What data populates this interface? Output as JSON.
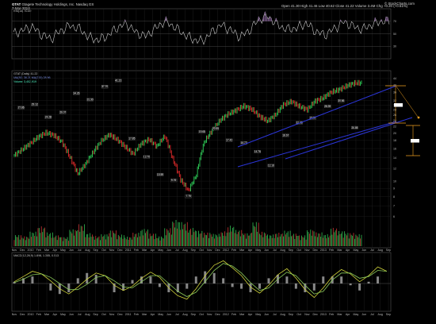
{
  "header": {
    "ticker": "GTAT",
    "company": "Gtagete Technology Holdings, Inc.",
    "exchange": "Nasdaq GS",
    "date": "7-Mar-2013",
    "ohlc": "Open 41.30  High 41.46  Low 40.62  Close 41.22  Volume 3.4M  Chg +0.20 (+0.51%)",
    "brand": "© StockCharts.com"
  },
  "panels": {
    "rsi_label": "RSI(14) 70.69",
    "price_label": "GTAT (Daily) 41.22",
    "ma_label": "MA(50) 38.21  MA(200) 28.96",
    "volume_label": "Volume 3,402,919",
    "macd_label": "MACD(12,26,9) 1.898, 1.385, 0.513"
  },
  "colors": {
    "background": "#000000",
    "grid": "#1d1d1d",
    "up": "#2fd35a",
    "down": "#e02a2a",
    "channel": "#2b35d8",
    "rsi_line": "#c8c8c8",
    "rsi_fill": "#7a5a8a",
    "macd": "#cfd23a",
    "macd_signal": "#8ac95a",
    "annotation": "#f0a020"
  },
  "chart_data": [
    {
      "type": "line",
      "title": "RSI(14)",
      "ylim": [
        10,
        90
      ],
      "y_ticks": [
        "70",
        "50",
        "30"
      ],
      "values_monthly": [
        50,
        56,
        61,
        48,
        42,
        55,
        63,
        58,
        44,
        40,
        47,
        60,
        66,
        52,
        46,
        58,
        70,
        62,
        50,
        41,
        38,
        52,
        64,
        56,
        45,
        55,
        73,
        78,
        64,
        57,
        59,
        67,
        54,
        48,
        58,
        69,
        62,
        57,
        65,
        70
      ]
    },
    {
      "type": "line",
      "title": "GTAT (Daily)",
      "ylim": [
        4,
        46
      ],
      "y_ticks": [
        "44",
        "40",
        "36",
        "32",
        "30",
        "28",
        "26",
        "24",
        "22",
        "20",
        "18",
        "16",
        "14",
        "12",
        "10",
        "9",
        "8",
        "7",
        "6"
      ],
      "x_ticks": [
        "Nov",
        "Dec",
        "2010",
        "Feb",
        "Mar",
        "Apr",
        "May",
        "Jun",
        "Jul",
        "Aug",
        "Sep",
        "Oct",
        "Nov",
        "Dec",
        "2011",
        "Feb",
        "Mar",
        "Apr",
        "May",
        "Jun",
        "Jul",
        "Aug",
        "Sep",
        "Oct",
        "Nov",
        "Dec",
        "2012",
        "Feb",
        "Mar",
        "Apr",
        "May",
        "Jun",
        "Jul",
        "Aug",
        "Sep",
        "Oct",
        "Nov",
        "Dec",
        "2013",
        "Feb",
        "Mar",
        "Apr",
        "May",
        "Jun",
        "Jul",
        "Aug",
        "Sep"
      ],
      "close_monthly": [
        14.5,
        15.8,
        17.2,
        18.9,
        20.1,
        19.4,
        17.6,
        14.2,
        11.1,
        12.8,
        15.3,
        17.9,
        19.6,
        18.2,
        16.4,
        14.8,
        17.1,
        18.3,
        16.5,
        19.2,
        13.8,
        10.2,
        8.7,
        10.9,
        17.6,
        20.8,
        24.1,
        26.3,
        27.8,
        29.6,
        28.2,
        25.4,
        23.8,
        26.1,
        30.2,
        31.6,
        29.4,
        28.1,
        31.8,
        33.2,
        36.1,
        37.4,
        39.6,
        41.22
      ],
      "pivot_labels": [
        "27.86",
        "29.12",
        "24.28",
        "26.07",
        "34.26",
        "31.30",
        "37.70",
        "41.22",
        "17.85",
        "13.70",
        "10.59",
        "9.76",
        "7.75",
        "19.65",
        "20.55",
        "17.42",
        "16.72",
        "14.76",
        "12.10",
        "18.67",
        "22.38",
        "23.97",
        "28.39",
        "30.66",
        "20.85"
      ],
      "annotations": [
        "12.55",
        "14.55"
      ]
    },
    {
      "type": "bar",
      "title": "Volume",
      "values_monthly": [
        3.2,
        2.8,
        4.1,
        5.6,
        3.9,
        3.1,
        2.6,
        4.8,
        6.2,
        3.7,
        2.9,
        3.4,
        4.5,
        3.3,
        2.7,
        3.8,
        4.9,
        3.6,
        2.8,
        5.1,
        7.4,
        6.8,
        5.2,
        4.4,
        3.9,
        3.5,
        4.2,
        5.8,
        4.6,
        3.7,
        6.9,
        4.1,
        3.3,
        3.8,
        4.4,
        3.6,
        3.1,
        4.7,
        3.9,
        3.4,
        5.2,
        4.3,
        3.8,
        3.4
      ]
    },
    {
      "type": "line",
      "title": "MACD(12,26,9)",
      "ylim": [
        -3,
        3
      ],
      "series": [
        {
          "name": "MACD",
          "values": [
            0.2,
            0.8,
            1.4,
            1.1,
            0.3,
            -0.6,
            -1.2,
            -0.4,
            0.5,
            1.2,
            0.9,
            -0.2,
            -0.8,
            -0.3,
            0.6,
            1.3,
            0.7,
            -0.5,
            -1.4,
            -1.8,
            -0.6,
            0.9,
            2.1,
            2.6,
            1.8,
            0.9,
            -0.4,
            -1.1,
            -0.2,
            1.0,
            1.7,
            0.6,
            -0.7,
            -1.6,
            -0.5,
            0.8,
            1.6,
            1.1,
            0.2,
            0.9,
            1.9,
            1.4
          ]
        },
        {
          "name": "Signal",
          "values": [
            0.1,
            0.5,
            1.0,
            1.1,
            0.7,
            0.0,
            -0.7,
            -0.7,
            -0.1,
            0.7,
            0.9,
            0.3,
            -0.4,
            -0.5,
            0.2,
            0.9,
            0.9,
            0.0,
            -0.9,
            -1.5,
            -1.0,
            0.2,
            1.5,
            2.3,
            2.0,
            1.2,
            0.1,
            -0.8,
            -0.5,
            0.5,
            1.3,
            0.9,
            -0.2,
            -1.2,
            -0.9,
            0.4,
            1.2,
            1.2,
            0.6,
            0.8,
            1.5,
            1.4
          ]
        }
      ]
    }
  ]
}
